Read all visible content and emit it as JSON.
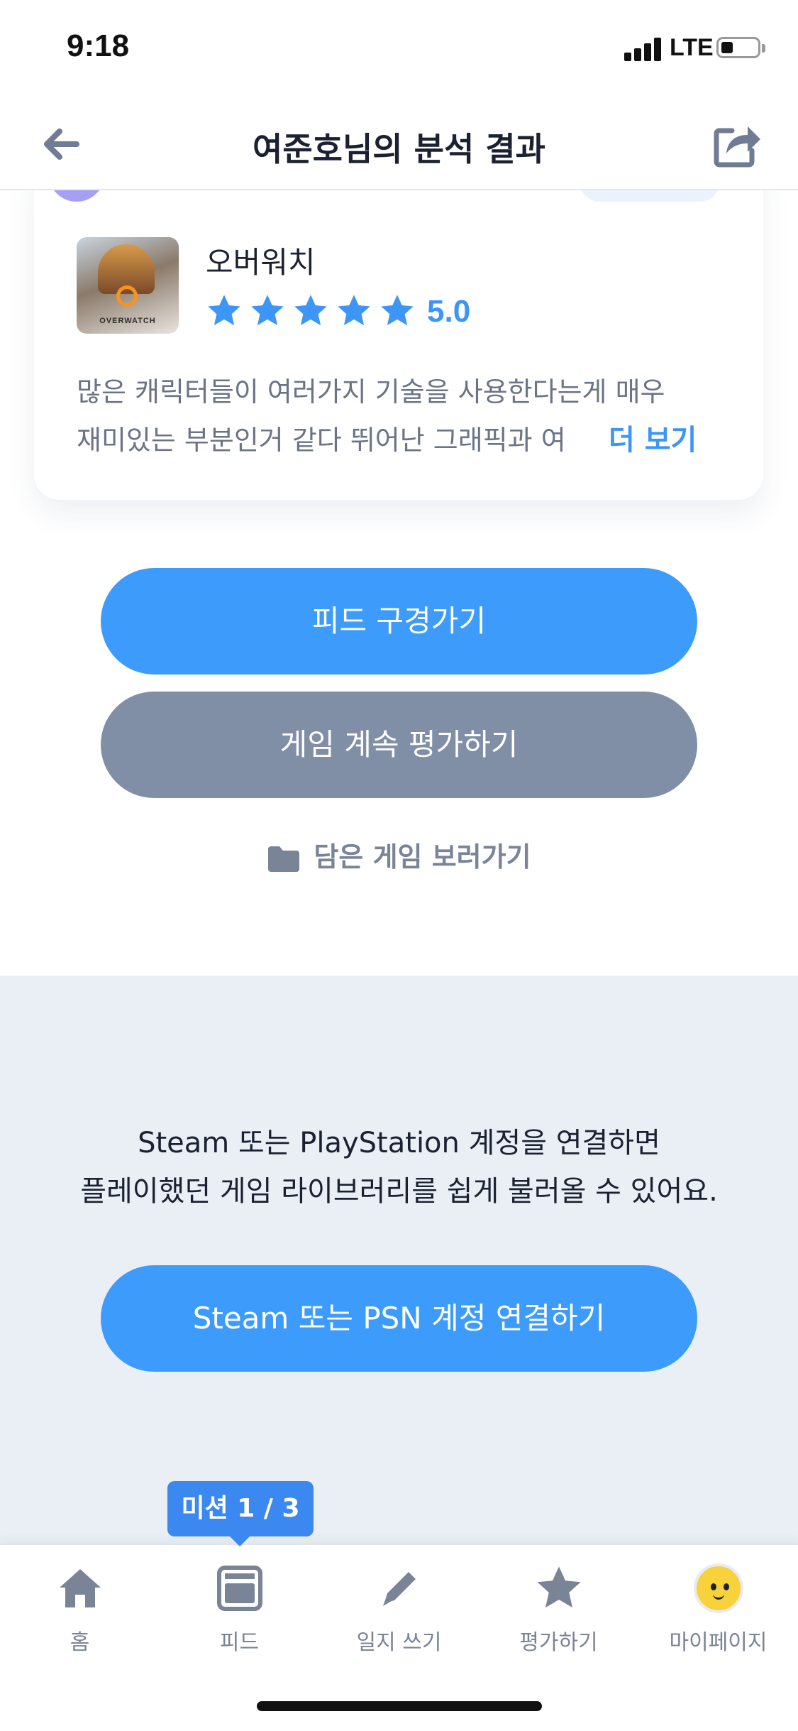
{
  "status_bar": {
    "time": "9:18",
    "network": "LTE"
  },
  "nav": {
    "title": "여준호님의 분석 결과"
  },
  "game_card": {
    "thumbnail_label": "OVERWATCH",
    "title": "오버워치",
    "rating": "5.0",
    "rating_value": 5,
    "rating_max": 5,
    "review_line1": "많은 캐릭터들이 여러가지 기술을 사용한다는게 매우",
    "review_line2": "재미있는 부분인거 같다 뛰어난 그래픽과 여",
    "more_label": "더 보기"
  },
  "buttons": {
    "feed": "피드 구경가기",
    "continue_rating": "게임 계속 평가하기",
    "saved_games": "담은 게임 보러가기"
  },
  "connect": {
    "line1": "Steam 또는 PlayStation 계정을 연결하면",
    "line2": "플레이했던 게임 라이브러리를 쉽게 불러올 수 있어요.",
    "button": "Steam 또는 PSN 계정 연결하기"
  },
  "mission": {
    "label": "미션 1 / 3"
  },
  "tabs": [
    {
      "label": "홈",
      "icon": "home-icon"
    },
    {
      "label": "피드",
      "icon": "feed-icon"
    },
    {
      "label": "일지 쓰기",
      "icon": "pencil-icon"
    },
    {
      "label": "평가하기",
      "icon": "star-icon"
    },
    {
      "label": "마이페이지",
      "icon": "avatar"
    }
  ],
  "colors": {
    "accent": "#3d9cfb",
    "secondary_button": "#808fa6",
    "star": "#3d95f5",
    "section_bg": "#eaeff6",
    "mission_badge": "#3b88f1"
  }
}
